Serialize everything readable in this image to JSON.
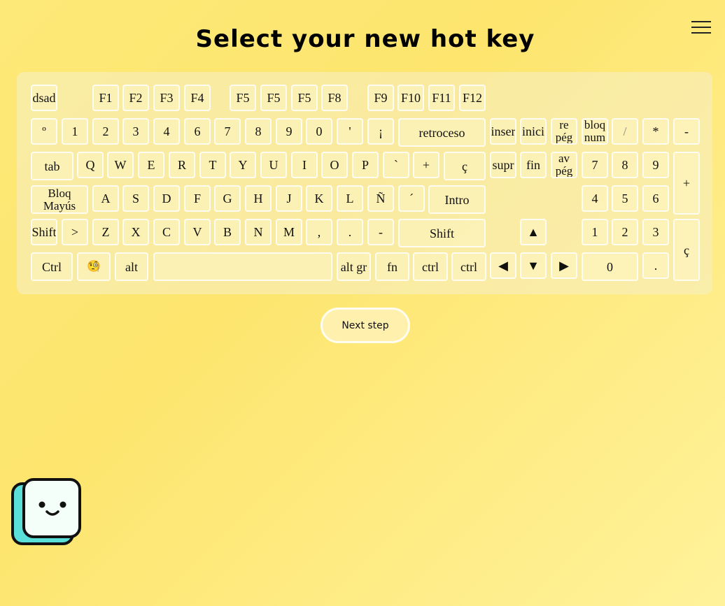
{
  "title": "Select your new hot key",
  "next_button": "Next step",
  "keyboard": {
    "row_fn": [
      "dsad",
      "F1",
      "F2",
      "F3",
      "F4",
      "F5",
      "F5",
      "F5",
      "F8",
      "F9",
      "F10",
      "F11",
      "F12"
    ],
    "row_num": [
      "º",
      "1",
      "2",
      "3",
      "4",
      "6",
      "7",
      "8",
      "9",
      "0",
      "'",
      "¡",
      "retroceso"
    ],
    "nav_top": [
      "inser",
      "inici",
      "re pég"
    ],
    "numpad_top": [
      "bloq num",
      "/",
      "*",
      "-"
    ],
    "row_q": [
      "tab",
      "Q",
      "W",
      "E",
      "R",
      "T",
      "Y",
      "U",
      "I",
      "O",
      "P",
      "`",
      "+",
      "ç"
    ],
    "nav_mid": [
      "supr",
      "fin",
      "av pég"
    ],
    "numpad_mid": [
      "7",
      "8",
      "9",
      "+"
    ],
    "row_a": [
      "Bloq Mayús",
      "A",
      "S",
      "D",
      "F",
      "G",
      "H",
      "J",
      "K",
      "L",
      "Ñ",
      "´",
      "Intro"
    ],
    "numpad_456": [
      "4",
      "5",
      "6"
    ],
    "row_z": [
      "Shift",
      ">",
      "Z",
      "X",
      "C",
      "V",
      "B",
      "N",
      "M",
      ",",
      ".",
      "-",
      "Shift"
    ],
    "arrow_up": "▲",
    "numpad_123": [
      "1",
      "2",
      "3",
      "ç"
    ],
    "row_bottom": [
      "Ctrl",
      "🧐",
      "alt",
      "",
      "alt gr",
      "fn",
      "ctrl",
      "ctrl"
    ],
    "arrows_bottom": [
      "◀",
      "▼",
      "▶"
    ],
    "numpad_bottom": [
      "0",
      "."
    ]
  },
  "colors": {
    "background": "#fde56e",
    "key_border": "#fffdf2",
    "mascot_body": "#5be0d9",
    "mascot_face": "#f3fff8"
  },
  "icons": {
    "menu": "hamburger-menu-icon",
    "mascot": "smiley-square-mascot"
  }
}
